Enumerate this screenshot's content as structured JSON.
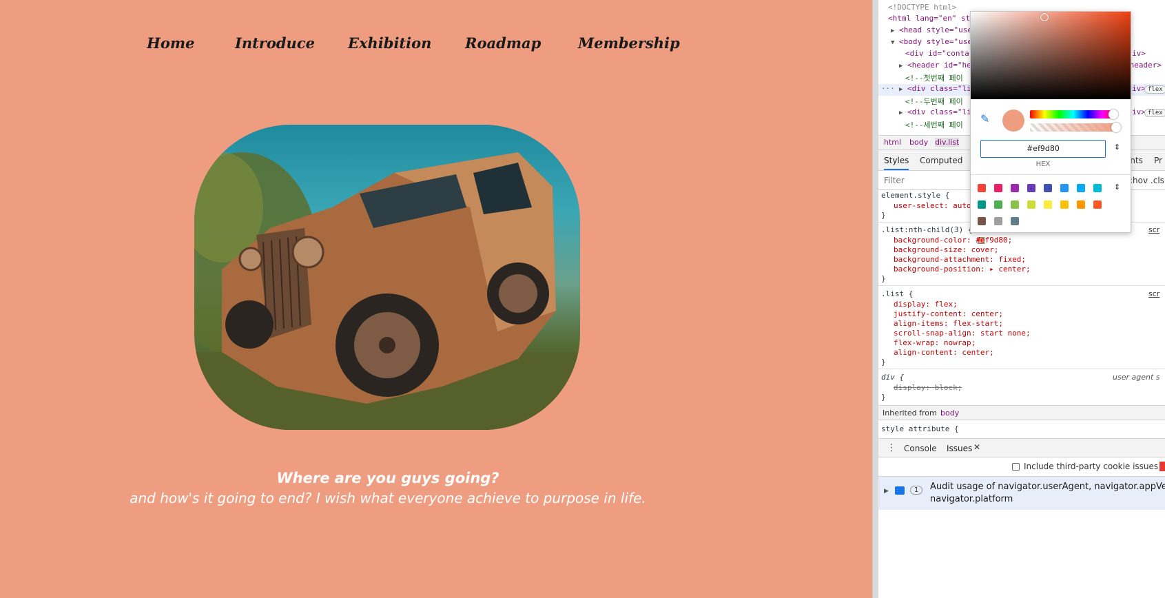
{
  "nav": {
    "items": [
      {
        "label": "Home"
      },
      {
        "label": "Introduce"
      },
      {
        "label": "Exhibition"
      },
      {
        "label": "Roadmap"
      },
      {
        "label": "Membership"
      }
    ]
  },
  "caption": {
    "title": "Where are you guys going?",
    "subtitle": "and how's it going to end? I wish what everyone achieve to purpose in life."
  },
  "devtools": {
    "elements": [
      "<!DOCTYPE html>",
      "<html lang=\"en\" st",
      "<head style=\"use",
      "<body style=\"use",
      "<div id=\"conta",
      "<header id=\"hea",
      "<!--첫번째 페이",
      "<div class=\"lis",
      "<!--두번째 페이",
      "<div class=\"lis",
      "<!--세번째 페이"
    ],
    "elements_tail": [
      "iv>",
      "<header>",
      "iv>",
      "iv>"
    ],
    "flex_badge": "flex",
    "breadcrumb": [
      "html",
      "body",
      "div.list"
    ],
    "tabs": [
      "Styles",
      "Computed",
      "ints",
      "Pr"
    ],
    "filter_placeholder": "Filter",
    "filter_right": ":hov .cls",
    "rules": [
      "element.style {",
      "user-select: auto",
      "}",
      ".list:nth-child(3) {",
      "background-color: #ef9d80;",
      "background-size: cover;",
      "background-attachment: fixed;",
      "background-position: ▸ center;",
      "}",
      ".list {",
      "display: flex;",
      "justify-content: center;",
      "align-items: flex-start;",
      "scroll-snap-align: start none;",
      "flex-wrap: nowrap;",
      "align-content: center;",
      "}",
      "div {",
      "display: block;",
      "}"
    ],
    "source_links": [
      "scr",
      "scr"
    ],
    "user_agent_label": "user agent s",
    "inherited_label": "Inherited from",
    "inherited_tag": "body",
    "style_attribute": "style attribute {",
    "drawer_tabs": [
      "Console",
      "Issues"
    ],
    "issues_checkbox_label": "Include third-party cookie issues",
    "issue_count": "1",
    "issue_text_line1": "Audit usage of navigator.userAgent, navigator.appVersi",
    "issue_text_line2": "navigator.platform"
  },
  "color_picker": {
    "hex_value": "#ef9d80",
    "format_label": "HEX",
    "current_color": "#ef9d80",
    "palette": [
      "#f44336",
      "#e91e63",
      "#9c27b0",
      "#673ab7",
      "#3f51b5",
      "#2196f3",
      "#03a9f4",
      "#00bcd4",
      "#009688",
      "#4caf50",
      "#8bc34a",
      "#cddc39",
      "#ffeb3b",
      "#ffc107",
      "#ff9800",
      "#ff5722",
      "#795548",
      "#9e9e9e",
      "#607d8b"
    ]
  },
  "colors": {
    "page_background": "#ef9d80",
    "nav_text": "#1a1a1a",
    "caption_text": "#ffffff"
  }
}
